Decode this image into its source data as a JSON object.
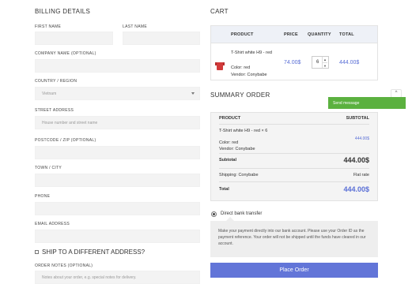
{
  "billing": {
    "title": "BILLING DETAILS",
    "first_name_label": "FIRST NAME",
    "last_name_label": "LAST NAME",
    "company_label": "COMPANY NAME (OPTIONAL)",
    "country_label": "COUNTRY / REGION",
    "country_value": "Vietnam",
    "street_label": "STREET ADDRESS",
    "street_placeholder": "House number and street name",
    "postcode_label": "POSTCODE / ZIP (OPTIONAL)",
    "town_label": "TOWN / CITY",
    "phone_label": "PHONE",
    "email_label": "EMAIL ADDRESS",
    "ship_different": "SHIP TO A DIFFERENT ADDRESS?",
    "order_notes_label": "ORDER NOTES (OPTIONAL)",
    "order_notes_placeholder": "Notes about your order, e.g. special notes for delivery."
  },
  "cart": {
    "title": "CART",
    "headers": {
      "product": "PRODUCT",
      "price": "PRICE",
      "quantity": "QUANTITY",
      "total": "TOTAL"
    },
    "item": {
      "name": "T-Shirt white H9 - red",
      "color_label": "Color:",
      "color_value": "red",
      "vendor_label": "Vendor:",
      "vendor_value": "Conybabe",
      "price": "74.00$",
      "quantity": "6",
      "total": "444.00$"
    }
  },
  "summary": {
    "title": "SUMMARY ORDER",
    "product_header": "PRODUCT",
    "subtotal_header": "SUBTOTAL",
    "line_name": "T-Shirt white H9 - red  × 6",
    "line_total": "444.00$",
    "color_label": "Color:",
    "color_value": "red",
    "vendor_label": "Vendor:",
    "vendor_value": "Conybabe",
    "subtotal_label": "Subtotal",
    "subtotal_value": "444.00$",
    "shipping_label": "Shipping: Conybabe",
    "shipping_value": "Flat rate",
    "total_label": "Total",
    "total_value": "444.00$"
  },
  "chat": {
    "send_message": "Send message",
    "toggle_icon": "^"
  },
  "payment": {
    "method": "Direct bank transfer",
    "description": "Make your payment directly into our bank account. Please use your Order ID as the payment reference. Your order will not be shipped until the funds have cleared in our account.",
    "place_order": "Place Order"
  },
  "colors": {
    "accent": "#6275d8",
    "chat": "#5bb13f",
    "price": "#5a6fd6"
  }
}
